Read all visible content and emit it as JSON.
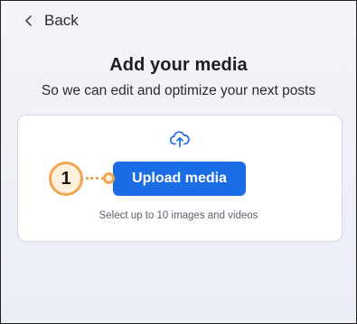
{
  "nav": {
    "back_label": "Back"
  },
  "header": {
    "title": "Add your media",
    "subtitle": "So we can edit and optimize your next posts"
  },
  "upload_card": {
    "icon": "cloud-upload-icon",
    "button_label": "Upload media",
    "hint": "Select up to 10 images and videos"
  },
  "annotation": {
    "step_number": "1"
  },
  "colors": {
    "accent": "#1b6de6",
    "callout_border": "#f0a64e",
    "callout_fill": "#fdf1dd"
  }
}
